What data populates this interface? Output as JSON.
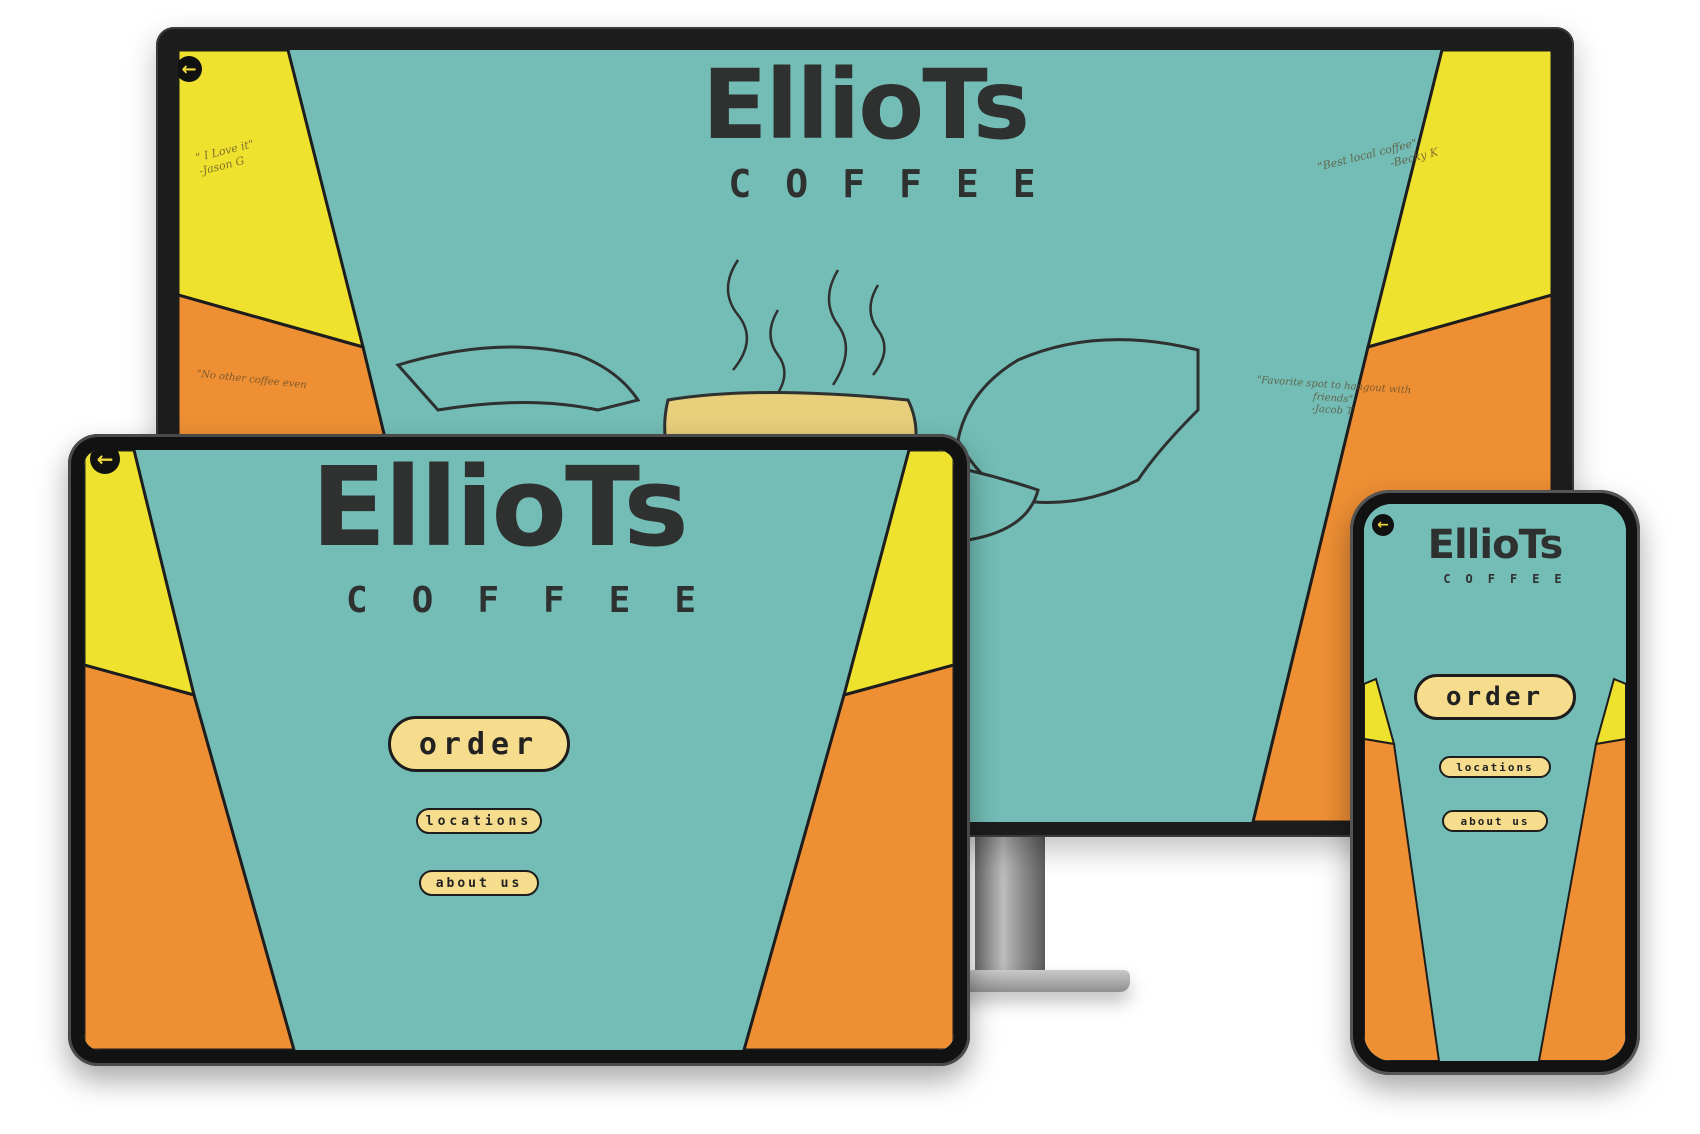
{
  "brand": {
    "name": "EllioTs",
    "subtitle": "COFFEE"
  },
  "nav": {
    "order": "order",
    "locations": "locations",
    "about": "about us",
    "back_icon": "arrow-left-icon"
  },
  "testimonials": [
    {
      "quote": "\" I Love it\"",
      "author": "-Jason G"
    },
    {
      "quote": "\"Best local coffee\"",
      "author": "-Becky K"
    },
    {
      "quote": "\"No other coffee even",
      "author": ""
    },
    {
      "quote": "\"Favorite spot to hangout with friends\"",
      "author": "-Jacob T"
    }
  ],
  "colors": {
    "teal": "#73bdb6",
    "yellow": "#efe22e",
    "orange": "#ee8f34",
    "cream": "#f6dd8d",
    "ink": "#2e3130"
  }
}
